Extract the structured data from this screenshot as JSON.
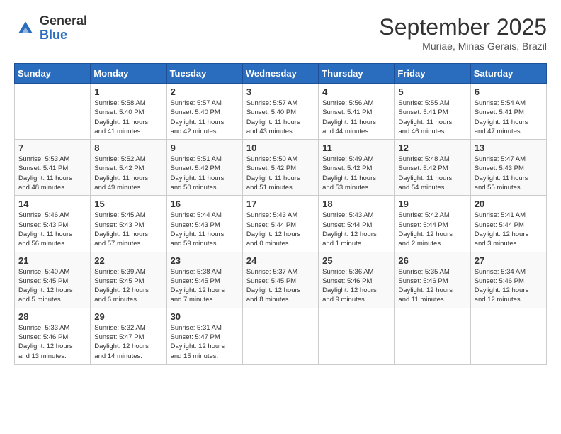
{
  "header": {
    "logo_general": "General",
    "logo_blue": "Blue",
    "month_title": "September 2025",
    "location": "Muriae, Minas Gerais, Brazil"
  },
  "days_of_week": [
    "Sunday",
    "Monday",
    "Tuesday",
    "Wednesday",
    "Thursday",
    "Friday",
    "Saturday"
  ],
  "weeks": [
    [
      {
        "day": "",
        "info": ""
      },
      {
        "day": "1",
        "info": "Sunrise: 5:58 AM\nSunset: 5:40 PM\nDaylight: 11 hours\nand 41 minutes."
      },
      {
        "day": "2",
        "info": "Sunrise: 5:57 AM\nSunset: 5:40 PM\nDaylight: 11 hours\nand 42 minutes."
      },
      {
        "day": "3",
        "info": "Sunrise: 5:57 AM\nSunset: 5:40 PM\nDaylight: 11 hours\nand 43 minutes."
      },
      {
        "day": "4",
        "info": "Sunrise: 5:56 AM\nSunset: 5:41 PM\nDaylight: 11 hours\nand 44 minutes."
      },
      {
        "day": "5",
        "info": "Sunrise: 5:55 AM\nSunset: 5:41 PM\nDaylight: 11 hours\nand 46 minutes."
      },
      {
        "day": "6",
        "info": "Sunrise: 5:54 AM\nSunset: 5:41 PM\nDaylight: 11 hours\nand 47 minutes."
      }
    ],
    [
      {
        "day": "7",
        "info": "Sunrise: 5:53 AM\nSunset: 5:41 PM\nDaylight: 11 hours\nand 48 minutes."
      },
      {
        "day": "8",
        "info": "Sunrise: 5:52 AM\nSunset: 5:42 PM\nDaylight: 11 hours\nand 49 minutes."
      },
      {
        "day": "9",
        "info": "Sunrise: 5:51 AM\nSunset: 5:42 PM\nDaylight: 11 hours\nand 50 minutes."
      },
      {
        "day": "10",
        "info": "Sunrise: 5:50 AM\nSunset: 5:42 PM\nDaylight: 11 hours\nand 51 minutes."
      },
      {
        "day": "11",
        "info": "Sunrise: 5:49 AM\nSunset: 5:42 PM\nDaylight: 11 hours\nand 53 minutes."
      },
      {
        "day": "12",
        "info": "Sunrise: 5:48 AM\nSunset: 5:42 PM\nDaylight: 11 hours\nand 54 minutes."
      },
      {
        "day": "13",
        "info": "Sunrise: 5:47 AM\nSunset: 5:43 PM\nDaylight: 11 hours\nand 55 minutes."
      }
    ],
    [
      {
        "day": "14",
        "info": "Sunrise: 5:46 AM\nSunset: 5:43 PM\nDaylight: 11 hours\nand 56 minutes."
      },
      {
        "day": "15",
        "info": "Sunrise: 5:45 AM\nSunset: 5:43 PM\nDaylight: 11 hours\nand 57 minutes."
      },
      {
        "day": "16",
        "info": "Sunrise: 5:44 AM\nSunset: 5:43 PM\nDaylight: 11 hours\nand 59 minutes."
      },
      {
        "day": "17",
        "info": "Sunrise: 5:43 AM\nSunset: 5:44 PM\nDaylight: 12 hours\nand 0 minutes."
      },
      {
        "day": "18",
        "info": "Sunrise: 5:43 AM\nSunset: 5:44 PM\nDaylight: 12 hours\nand 1 minute."
      },
      {
        "day": "19",
        "info": "Sunrise: 5:42 AM\nSunset: 5:44 PM\nDaylight: 12 hours\nand 2 minutes."
      },
      {
        "day": "20",
        "info": "Sunrise: 5:41 AM\nSunset: 5:44 PM\nDaylight: 12 hours\nand 3 minutes."
      }
    ],
    [
      {
        "day": "21",
        "info": "Sunrise: 5:40 AM\nSunset: 5:45 PM\nDaylight: 12 hours\nand 5 minutes."
      },
      {
        "day": "22",
        "info": "Sunrise: 5:39 AM\nSunset: 5:45 PM\nDaylight: 12 hours\nand 6 minutes."
      },
      {
        "day": "23",
        "info": "Sunrise: 5:38 AM\nSunset: 5:45 PM\nDaylight: 12 hours\nand 7 minutes."
      },
      {
        "day": "24",
        "info": "Sunrise: 5:37 AM\nSunset: 5:45 PM\nDaylight: 12 hours\nand 8 minutes."
      },
      {
        "day": "25",
        "info": "Sunrise: 5:36 AM\nSunset: 5:46 PM\nDaylight: 12 hours\nand 9 minutes."
      },
      {
        "day": "26",
        "info": "Sunrise: 5:35 AM\nSunset: 5:46 PM\nDaylight: 12 hours\nand 11 minutes."
      },
      {
        "day": "27",
        "info": "Sunrise: 5:34 AM\nSunset: 5:46 PM\nDaylight: 12 hours\nand 12 minutes."
      }
    ],
    [
      {
        "day": "28",
        "info": "Sunrise: 5:33 AM\nSunset: 5:46 PM\nDaylight: 12 hours\nand 13 minutes."
      },
      {
        "day": "29",
        "info": "Sunrise: 5:32 AM\nSunset: 5:47 PM\nDaylight: 12 hours\nand 14 minutes."
      },
      {
        "day": "30",
        "info": "Sunrise: 5:31 AM\nSunset: 5:47 PM\nDaylight: 12 hours\nand 15 minutes."
      },
      {
        "day": "",
        "info": ""
      },
      {
        "day": "",
        "info": ""
      },
      {
        "day": "",
        "info": ""
      },
      {
        "day": "",
        "info": ""
      }
    ]
  ]
}
